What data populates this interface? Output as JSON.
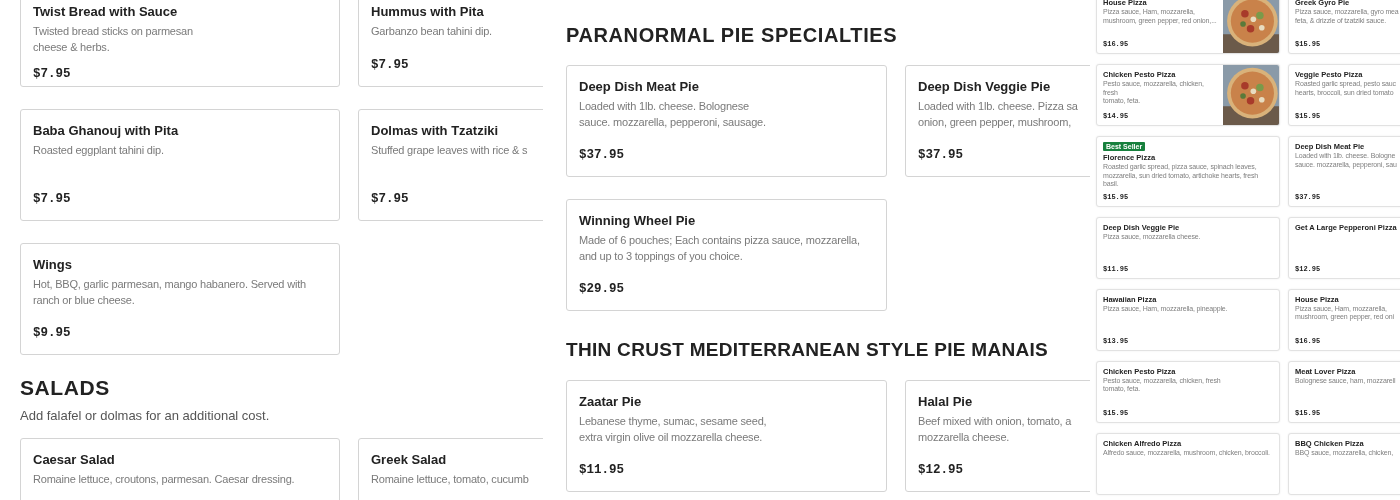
{
  "panels": [
    {
      "blocks": [
        {
          "kind": "cards",
          "cards": [
            {
              "title": "Twist Bread with Sauce",
              "lines": [
                "Twisted bread sticks on parmesan",
                "cheese & herbs."
              ],
              "price": "$7.95"
            },
            {
              "title": "Hummus with Pita",
              "lines": [
                "Garbanzo bean tahini dip."
              ],
              "price": "$7.95"
            }
          ]
        },
        {
          "kind": "cards",
          "cards": [
            {
              "title": "Baba Ghanouj with Pita",
              "lines": [
                "Roasted eggplant tahini dip."
              ],
              "price": "$7.95"
            },
            {
              "title": "Dolmas with Tzatziki",
              "lines": [
                "Stuffed grape leaves with rice & s"
              ],
              "price": "$7.95"
            }
          ]
        },
        {
          "kind": "cards",
          "cards": [
            {
              "title": "Wings",
              "lines": [
                "Hot, BBQ, garlic parmesan, mango habanero. Served with",
                "ranch or blue cheese."
              ],
              "price": "$9.95"
            }
          ]
        },
        {
          "kind": "heading",
          "text": "SALADS"
        },
        {
          "kind": "note",
          "text": "Add falafel or dolmas for an additional cost."
        },
        {
          "kind": "cards",
          "cards": [
            {
              "title": "Caesar Salad",
              "lines": [
                "Romaine lettuce, croutons, parmesan. Caesar dressing."
              ]
            },
            {
              "title": "Greek Salad",
              "lines": [
                "Romaine lettuce, tomato, cucumb"
              ]
            }
          ]
        }
      ]
    },
    {
      "blocks": [
        {
          "kind": "heading",
          "text": "PARANORMAL PIE SPECIALTIES"
        },
        {
          "kind": "cards",
          "cards": [
            {
              "title": "Deep Dish Meat Pie",
              "lines": [
                "Loaded with 1lb. cheese. Bolognese",
                "sauce. mozzarella, pepperoni, sausage."
              ],
              "price": "$37.95"
            },
            {
              "title": "Deep Dish Veggie Pie",
              "lines": [
                "Loaded with 1lb. cheese. Pizza sa",
                "onion, green pepper, mushroom,"
              ],
              "price": "$37.95"
            }
          ]
        },
        {
          "kind": "cards",
          "cards": [
            {
              "title": "Winning Wheel Pie",
              "lines": [
                "Made of 6 pouches; Each contains pizza sauce, mozzarella,",
                "and up to 3 toppings of you choice."
              ],
              "price": "$29.95"
            }
          ]
        },
        {
          "kind": "heading",
          "text": "THIN CRUST MEDITERRANEAN STYLE PIE MANAIS"
        },
        {
          "kind": "cards",
          "cards": [
            {
              "title": "Zaatar Pie",
              "lines": [
                "Lebanese thyme, sumac, sesame seed,",
                "extra virgin olive oil mozzarella cheese."
              ],
              "price": "$11.95"
            },
            {
              "title": "Halal Pie",
              "lines": [
                "Beef mixed with onion, tomato, a",
                "mozzarella cheese."
              ],
              "price": "$12.95"
            }
          ]
        }
      ]
    },
    {
      "blocks": [
        {
          "kind": "cards",
          "cards": [
            {
              "title": "House Pizza",
              "lines": [
                "Pizza sauce, Ham, mozzarella,",
                "mushroom, green pepper, red onion,..."
              ],
              "price": "$16.95",
              "image": {
                "kind": "picture"
              }
            },
            {
              "title": "Greek Gyro Pie",
              "lines": [
                "Pizza sauce, mozzarella, gyro mea",
                "feta, & drizzle of tzatziki sauce."
              ],
              "price": "$15.95"
            }
          ]
        },
        {
          "kind": "cards",
          "cards": [
            {
              "title": "Chicken Pesto Pizza",
              "lines": [
                "Pesto sauce, mozzarella, chicken, fresh",
                "tomato, feta."
              ],
              "price": "$14.95",
              "image": {
                "kind": "picture"
              }
            },
            {
              "title": "Veggie Pesto Pizza",
              "lines": [
                "Roasted garlic spread, pesto sauc",
                "hearts, broccoli, sun dried tomato"
              ],
              "price": "$15.95"
            }
          ]
        },
        {
          "kind": "cards",
          "cards": [
            {
              "badge": "Best Seller",
              "title": "Florence Pizza",
              "lines": [
                "Roasted garlic spread, pizza sauce, spinach leaves,",
                "mozzarella, sun dried tomato, artichoke hearts, fresh basil."
              ],
              "price": "$15.95"
            },
            {
              "title": "Deep Dish Meat Pie",
              "lines": [
                "Loaded with 1lb. cheese. Bologne",
                "sauce. mozzarella, pepperoni, sau"
              ],
              "price": "$37.95"
            }
          ]
        },
        {
          "kind": "cards",
          "cards": [
            {
              "title": "Deep Dish Veggie Pie",
              "lines": [
                "Pizza sauce, mozzarella cheese."
              ],
              "price": "$11.95"
            },
            {
              "title": "Get A Large Pepperoni Pizza",
              "price": "$12.95"
            }
          ]
        },
        {
          "kind": "cards",
          "cards": [
            {
              "title": "Hawaiian Pizza",
              "lines": [
                "Pizza sauce, Ham, mozzarella, pineapple."
              ],
              "price": "$13.95"
            },
            {
              "title": "House Pizza",
              "lines": [
                "Pizza sauce, Ham, mozzarella,",
                "mushroom, green pepper, red oni"
              ],
              "price": "$16.95"
            }
          ]
        },
        {
          "kind": "cards",
          "cards": [
            {
              "title": "Chicken Pesto Pizza",
              "lines": [
                "Pesto sauce, mozzarella, chicken, fresh",
                "tomato, feta."
              ],
              "price": "$15.95"
            },
            {
              "title": "Meat Lover Pizza",
              "lines": [
                "Bolognese sauce, ham, mozzarell"
              ],
              "price": "$15.95"
            }
          ]
        },
        {
          "kind": "cards",
          "cards": [
            {
              "title": "Chicken Alfredo Pizza",
              "lines": [
                "Alfredo sauce, mozzarella, mushroom, chicken, broccoli."
              ]
            },
            {
              "title": "BBQ Chicken Pizza",
              "lines": [
                "BBQ sauce, mozzarella, chicken,"
              ]
            }
          ]
        }
      ]
    }
  ]
}
